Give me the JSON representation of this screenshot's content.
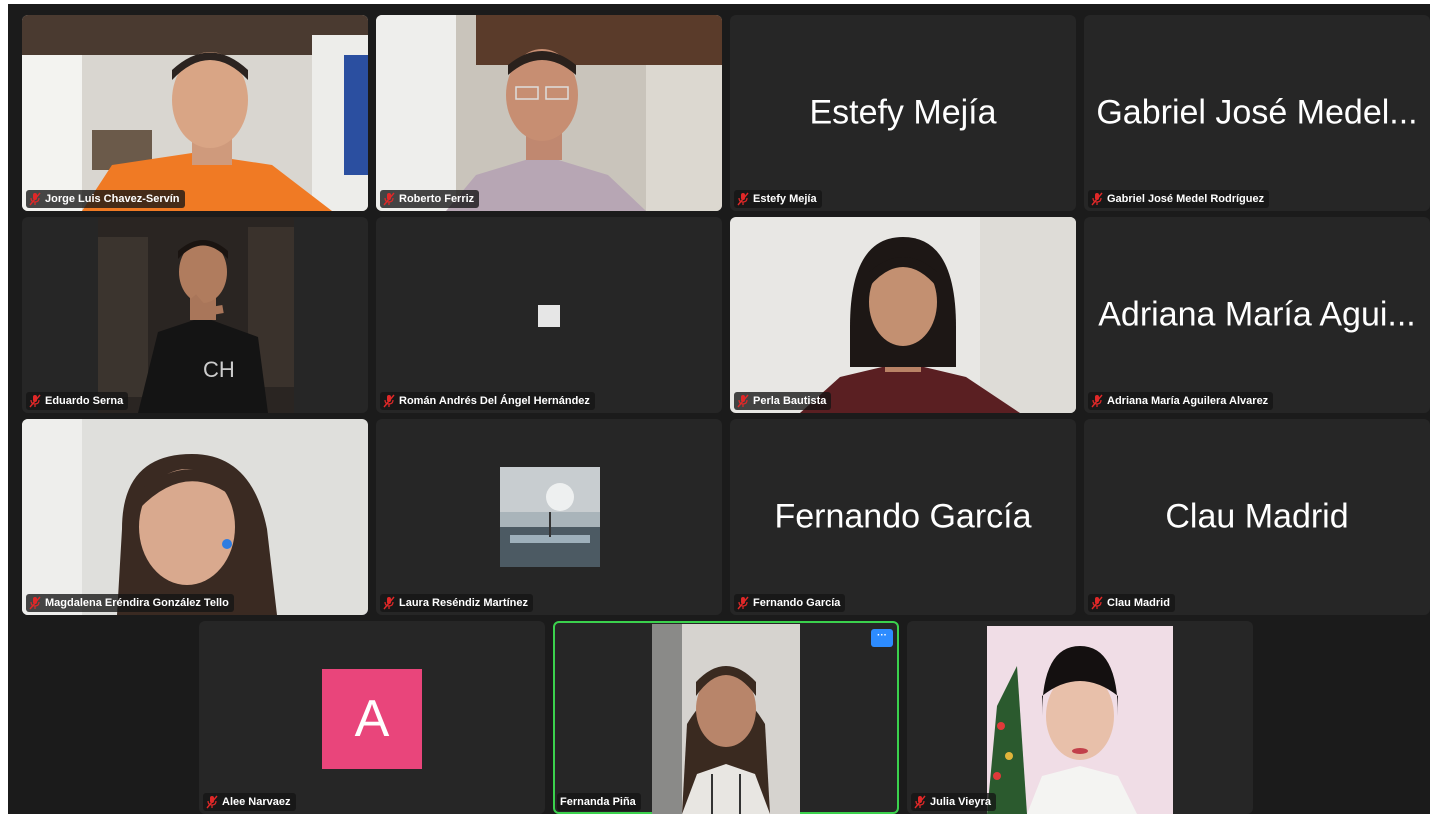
{
  "participants": [
    {
      "display_name": "",
      "label": "Jorge Luis Chavez-Servín",
      "video": "person-orange-shirt"
    },
    {
      "display_name": "",
      "label": "Roberto Ferriz",
      "video": "person-glasses-plaid"
    },
    {
      "display_name": "Estefy Mejía",
      "label": "Estefy Mejía"
    },
    {
      "display_name": "Gabriel José Medel...",
      "label": "Gabriel José Medel Rodríguez"
    },
    {
      "display_name": "",
      "label": "Eduardo Serna",
      "video": "person-hand-chin"
    },
    {
      "display_name": "",
      "label": "Román Andrés Del Ángel Hernández"
    },
    {
      "display_name": "",
      "label": "Perla Bautista",
      "video": "person-maroon-top"
    },
    {
      "display_name": "Adriana María Agui...",
      "label": "Adriana María Aguilera Alvarez"
    },
    {
      "display_name": "",
      "label": "Magdalena Eréndira González Tello",
      "video": "person-earbuds"
    },
    {
      "display_name": "",
      "label": "Laura Reséndiz Martínez",
      "video": "landscape-thumbnail"
    },
    {
      "display_name": "Fernando García",
      "label": "Fernando García"
    },
    {
      "display_name": "Clau Madrid",
      "label": "Clau Madrid"
    },
    {
      "display_name": "",
      "label": "Alee Narvaez",
      "avatar_letter": "A"
    },
    {
      "display_name": "",
      "label": "Fernanda Piña",
      "video": "person-speaking",
      "active_speaker": true,
      "more_label": "···"
    },
    {
      "display_name": "",
      "label": "Julia Vieyra",
      "video": "person-christmas-tree"
    }
  ],
  "icons": {
    "muted": "mic-muted-icon",
    "more": "more-options-icon"
  },
  "colors": {
    "active_border": "#3bd14d",
    "muted_icon": "#e02828",
    "avatar_bg": "#e9457b",
    "more_button": "#2d8cff"
  }
}
